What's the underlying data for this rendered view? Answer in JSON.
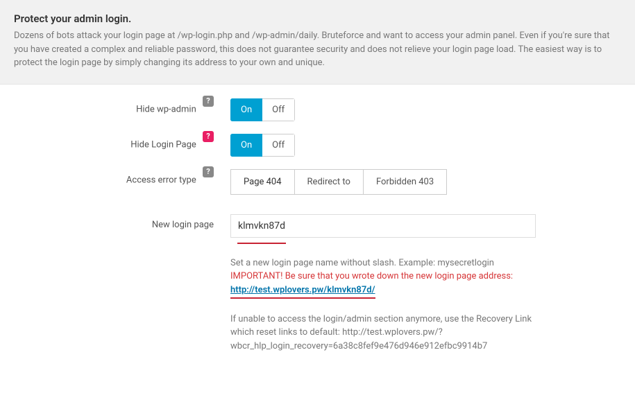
{
  "header": {
    "title": "Protect your admin login.",
    "desc": "Dozens of bots attack your login page at /wp-login.php and /wp-admin/daily. Bruteforce and want to access your admin panel. Even if you're sure that you have created a complex and reliable password, this does not guarantee security and does not relieve your login page load. The easiest way is to protect the login page by simply changing its address to your own and unique."
  },
  "rows": {
    "hide_wp_admin": {
      "label": "Hide wp-admin",
      "on": "On",
      "off": "Off",
      "value": "On"
    },
    "hide_login": {
      "label": "Hide Login Page",
      "on": "On",
      "off": "Off",
      "value": "On"
    },
    "access_error": {
      "label": "Access error type",
      "opt1": "Page 404",
      "opt2": "Redirect to",
      "opt3": "Forbidden 403",
      "value": "Page 404"
    },
    "new_login": {
      "label": "New login page",
      "value": "klmvkn87d",
      "hint1": "Set a new login page name without slash. Example: mysecretlogin",
      "important": "IMPORTANT! Be sure that you wrote down the new login page address:",
      "url": "http://test.wplovers.pw/klmvkn87d/",
      "hint2": "If unable to access the login/admin section anymore, use the Recovery Link which reset links to default: http://test.wplovers.pw/?wbcr_hlp_login_recovery=6a38c8fef9e476d946e912efbc9914b7"
    }
  },
  "help_glyph": "?"
}
